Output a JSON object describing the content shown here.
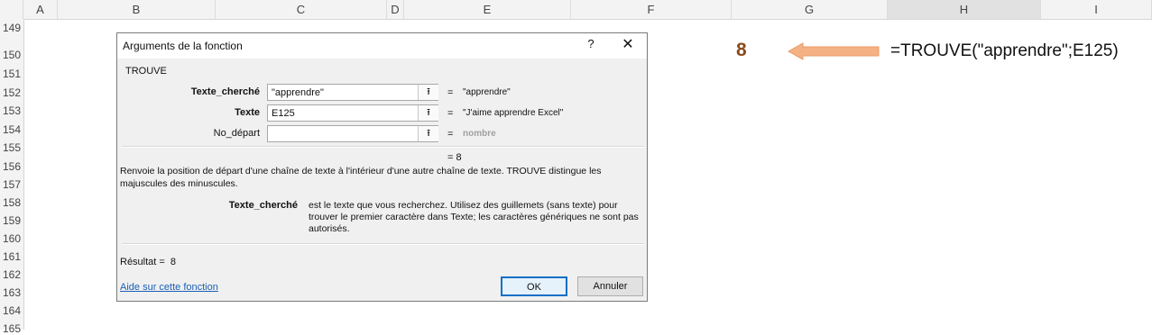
{
  "columns": [
    "A",
    "B",
    "C",
    "D",
    "E",
    "F",
    "G",
    "H",
    "I"
  ],
  "rows": [
    "149",
    "150",
    "151",
    "152",
    "153",
    "154",
    "155",
    "156",
    "157",
    "158",
    "159",
    "160",
    "161",
    "162",
    "163",
    "164",
    "165"
  ],
  "cell_result": "8",
  "cell_formula": "=TROUVE(\"apprendre\";E125)",
  "colors": {
    "arrow": "#f4b183",
    "result": "#8a4a1c",
    "ok_border": "#0f6fc6"
  },
  "dialog": {
    "title": "Arguments de la fonction",
    "help_glyph": "?",
    "close_glyph": "✕",
    "function_name": "TROUVE",
    "args": [
      {
        "label": "Texte_cherché",
        "value": "\"apprendre\"",
        "equals": "=",
        "result": "\"apprendre\""
      },
      {
        "label": "Texte",
        "value": "E125",
        "equals": "=",
        "result": "\"J'aime apprendre Excel\""
      },
      {
        "label": "No_départ",
        "value": "",
        "equals": "=",
        "result": "nombre"
      }
    ],
    "ref_button_glyph": "⭱",
    "formula_result": "=   8",
    "description": "Renvoie la position de départ d'une chaîne de texte à l'intérieur d'une autre chaîne de texte. TROUVE distingue les majuscules des minuscules.",
    "arg_help_name": "Texte_cherché",
    "arg_help_text": "est le texte que vous recherchez. Utilisez des guillemets (sans texte) pour trouver le premier caractère dans Texte; les caractères génériques ne sont pas autorisés.",
    "resultat_label": "Résultat =",
    "resultat_value": "8",
    "help_link": "Aide sur cette fonction",
    "ok_label": "OK",
    "cancel_label": "Annuler"
  }
}
